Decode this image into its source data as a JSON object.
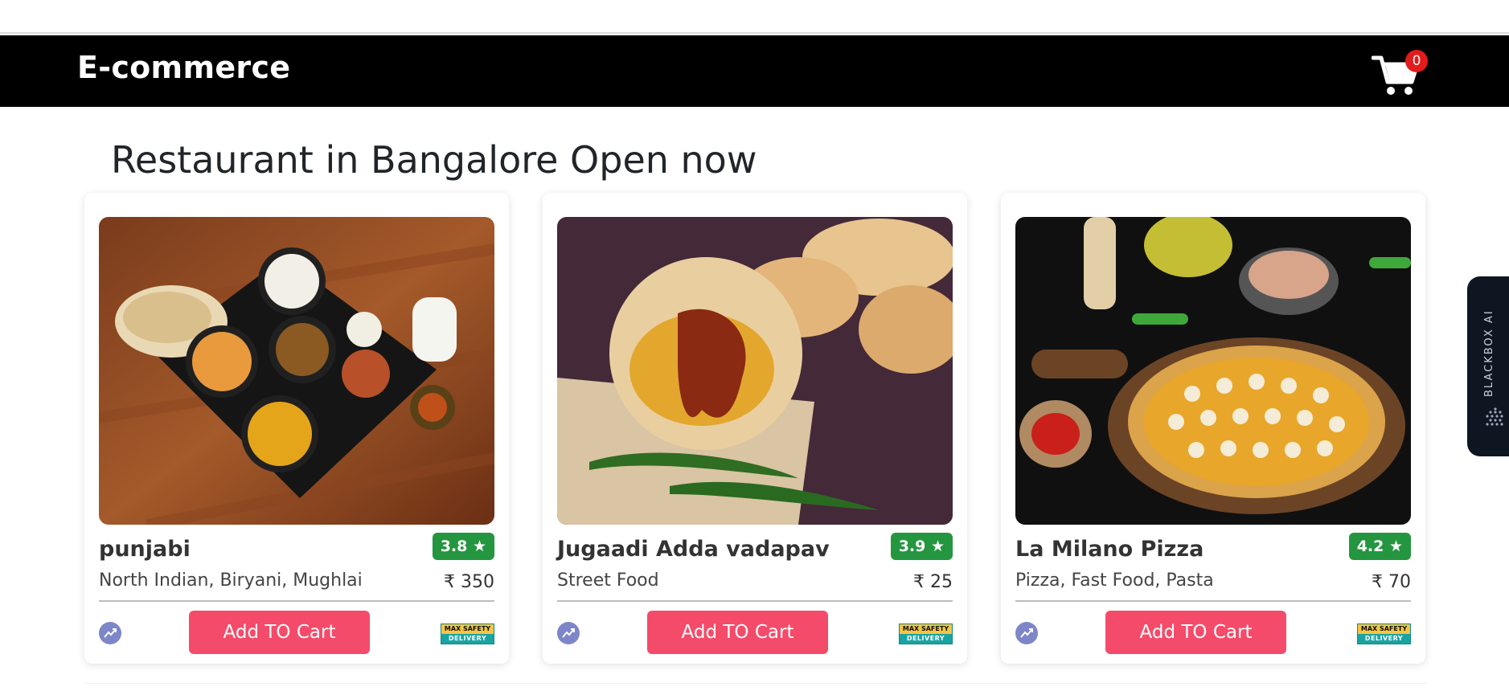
{
  "navbar": {
    "brand": "E-commerce",
    "cart_count": "0"
  },
  "heading": "Restaurant in Bangalore Open now",
  "restaurants": [
    {
      "name": "punjabi",
      "rating": "3.8 ★",
      "cuisine": "North Indian, Biryani, Mughlai",
      "price": "₹ 350",
      "button_label": "Add TO Cart"
    },
    {
      "name": "Jugaadi Adda vadapav",
      "rating": "3.9 ★",
      "cuisine": "Street Food",
      "price": "₹ 25",
      "button_label": "Add TO Cart"
    },
    {
      "name": "La Milano Pizza",
      "rating": "4.2 ★",
      "cuisine": "Pizza, Fast Food, Pasta",
      "price": "₹ 70",
      "button_label": "Add TO Cart"
    }
  ],
  "safety_badge": {
    "line1": "MAX SAFETY",
    "line2": "DELIVERY"
  },
  "sidebar_tab": {
    "label": "BLACKBOX AI"
  },
  "colors": {
    "navbar_bg": "#000000",
    "button_bg": "#f54b6a",
    "rating_bg": "#24963f",
    "badge_bg": "#e21b1b"
  },
  "icons": [
    "cart-icon",
    "trend-icon",
    "blackbox-logo-icon"
  ]
}
